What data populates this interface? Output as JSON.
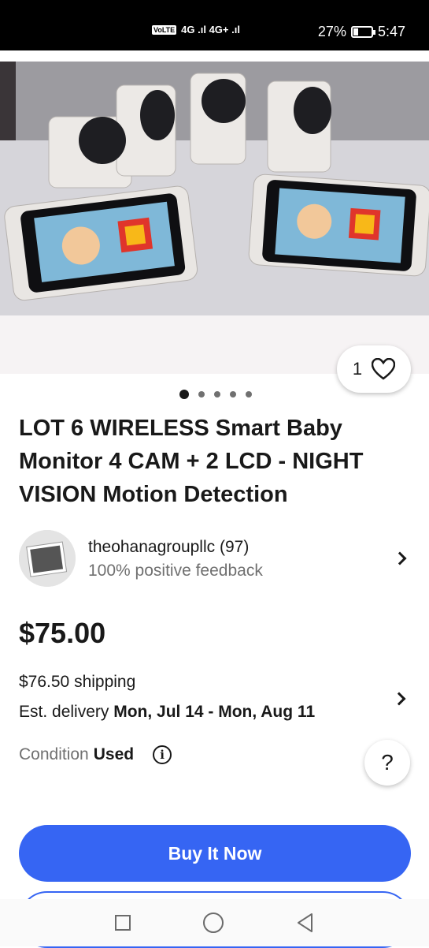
{
  "status_bar": {
    "network": "VoLTE 1  4G  4G+",
    "volte_badge": "VoLTE",
    "signal_text": "4G .ıl 4G+ .ıl",
    "battery_percent": "27%",
    "battery_level": 0.27,
    "time": "5:47"
  },
  "gallery": {
    "like_count": "1",
    "image_count": 5,
    "active_index": 0
  },
  "listing": {
    "title": "LOT 6 WIRELESS Smart Baby Monitor 4 CAM + 2 LCD - NIGHT VISION Motion Detection",
    "seller_name": "theohanagroupllc (97)",
    "seller_feedback": "100% positive feedback",
    "price": "$75.00",
    "shipping": "$76.50 shipping",
    "delivery_label": "Est. delivery ",
    "delivery_dates": "Mon, Jul 14 - Mon, Aug 11",
    "condition_label": "Condition ",
    "condition_value": "Used"
  },
  "actions": {
    "buy_now": "Buy It Now",
    "help": "?"
  },
  "colors": {
    "accent": "#3665f3",
    "text": "#191919",
    "muted": "#707070"
  },
  "icons": [
    "heart-icon",
    "chevron-right-icon",
    "info-icon",
    "question-icon",
    "nav-square-icon",
    "nav-circle-icon",
    "nav-back-icon"
  ]
}
